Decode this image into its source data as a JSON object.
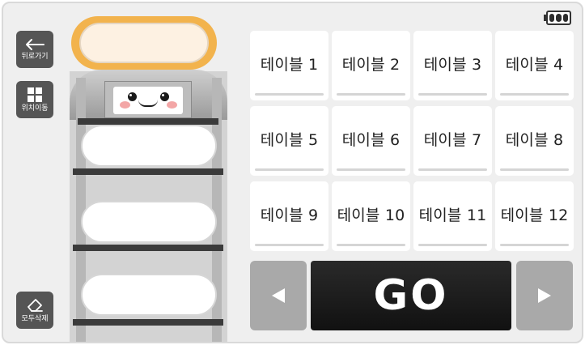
{
  "toolbar": {
    "back_label": "뒤로가기",
    "move_label": "위치이동",
    "clear_label": "모두삭제"
  },
  "status": {
    "battery_level": 1.0
  },
  "tables": [
    "테이블 1",
    "테이블 2",
    "테이블 3",
    "테이블 4",
    "테이블 5",
    "테이블 6",
    "테이블 7",
    "테이블 8",
    "테이블 9",
    "테이블 10",
    "테이블 11",
    "테이블 12"
  ],
  "controls": {
    "go_label": "GO",
    "prev_icon": "triangle-left-icon",
    "next_icon": "triangle-right-icon"
  },
  "robot": {
    "trays": [
      "",
      "",
      "",
      ""
    ],
    "selected_tray": 0
  },
  "colors": {
    "accent": "#f2b34d",
    "button_dark": "#555555",
    "go_bg": "#1a1a1a",
    "arrow_bg": "#a9a9a9"
  }
}
